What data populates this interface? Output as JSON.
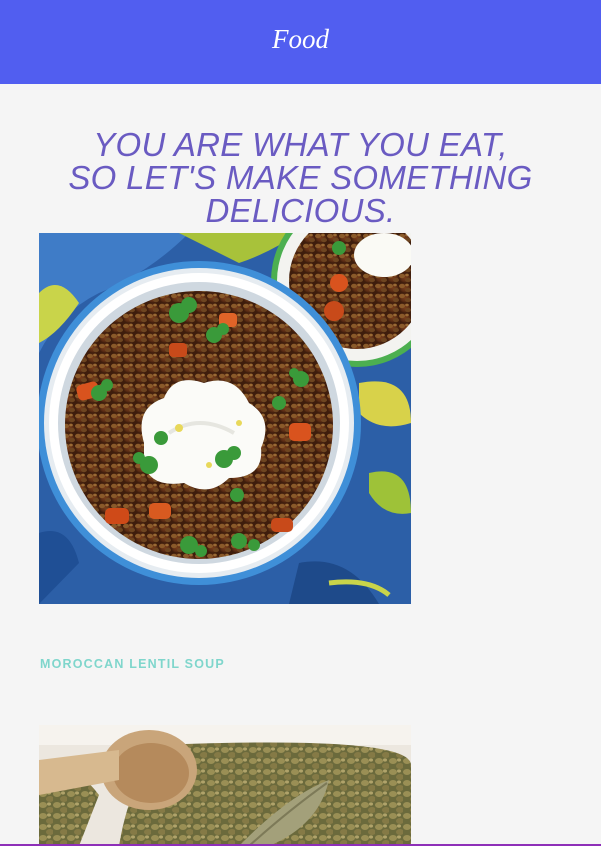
{
  "header": {
    "title": "Food"
  },
  "hero": {
    "tagline_lines": [
      "YOU ARE WHAT YOU EAT,",
      "SO LET'S MAKE SOMETHING",
      "DELICIOUS."
    ]
  },
  "recipes": [
    {
      "name": "MOROCCAN LENTIL SOUP",
      "image_icon": "lentil-soup-bowl-photo"
    },
    {
      "name": "",
      "image_icon": "green-lentils-wooden-spoon-photo"
    }
  ],
  "colors": {
    "header_bg": "#515ef0",
    "tagline": "#6a5bc2",
    "recipe_name": "#7fd6cc",
    "page_bg": "#f5f5f5"
  }
}
